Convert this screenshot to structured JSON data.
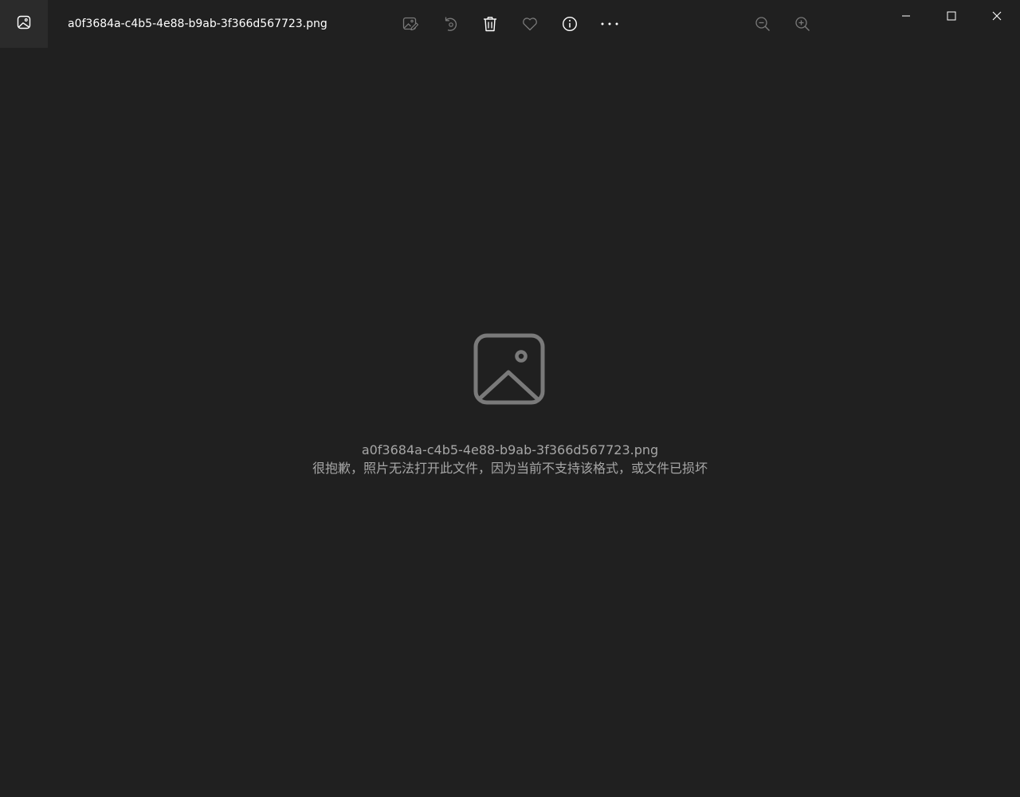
{
  "window": {
    "title": "a0f3684a-c4b5-4e88-b9ab-3f366d567723.png"
  },
  "toolbar": {
    "items": [
      {
        "icon": "edit-image-icon",
        "enabled": false
      },
      {
        "icon": "rotate-icon",
        "enabled": false
      },
      {
        "icon": "delete-icon",
        "enabled": true
      },
      {
        "icon": "favorite-heart-icon",
        "enabled": false
      },
      {
        "icon": "info-icon",
        "enabled": true
      },
      {
        "icon": "more-options-icon",
        "enabled": true
      }
    ],
    "zoom": [
      {
        "icon": "zoom-out-icon",
        "enabled": false
      },
      {
        "icon": "zoom-in-icon",
        "enabled": false
      }
    ]
  },
  "window_controls": [
    "minimize-icon",
    "maximize-icon",
    "close-icon"
  ],
  "error": {
    "filename": "a0f3684a-c4b5-4e88-b9ab-3f366d567723.png",
    "message": "很抱歉，照片无法打开此文件，因为当前不支持该格式，或文件已损坏"
  },
  "colors": {
    "background": "#202020",
    "text_primary": "#ffffff",
    "text_secondary": "#a6a6a6",
    "icon_disabled": "#7a7a7a"
  }
}
